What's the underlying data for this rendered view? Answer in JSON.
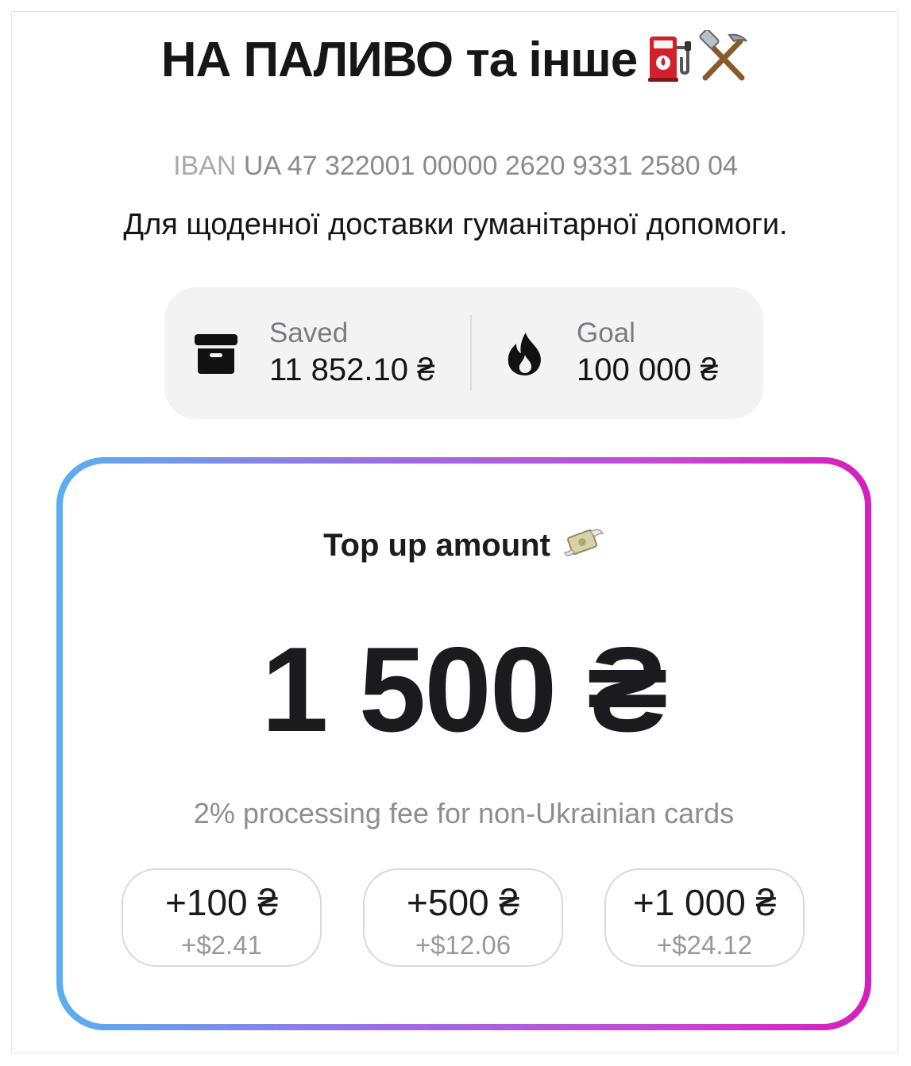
{
  "header": {
    "title": "НА ПАЛИВО та інше",
    "title_icons": [
      "fuel-pump-icon",
      "hammer-and-pick-icon"
    ]
  },
  "account": {
    "iban_label": "IBAN",
    "iban_value": "UA 47 322001 00000 2620 9331 2580 04"
  },
  "description": "Для щоденної доставки гуманітарної допомоги.",
  "stats": {
    "saved_label": "Saved",
    "saved_value": "11 852.10 ₴",
    "saved_icon": "archive-box-icon",
    "goal_label": "Goal",
    "goal_value": "100 000 ₴",
    "goal_icon": "flame-icon"
  },
  "topup": {
    "label": "Top up amount",
    "label_icon": "money-with-wings-icon",
    "amount": "1 500 ₴",
    "fee_note": "2% processing fee for non-Ukrainian cards",
    "presets": [
      {
        "amount": "+100 ₴",
        "usd": "+$2.41"
      },
      {
        "amount": "+500 ₴",
        "usd": "+$12.06"
      },
      {
        "amount": "+1 000 ₴",
        "usd": "+$24.12"
      }
    ]
  },
  "colors": {
    "gradient_start": "#5aafef",
    "gradient_mid": "#9b6fe0",
    "gradient_end": "#d41fbc",
    "text_primary": "#1b1b1f",
    "text_muted": "#8d8d92"
  }
}
